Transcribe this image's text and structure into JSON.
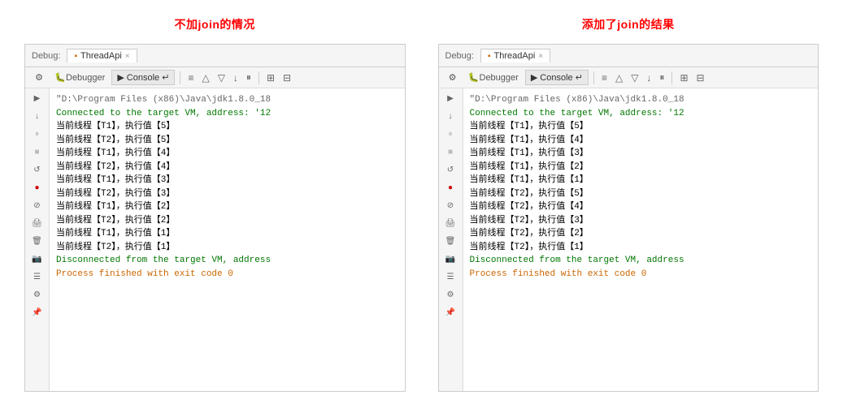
{
  "left_section": {
    "title": "不加join的情况",
    "debug_label": "Debug:",
    "tab_name": "ThreadApi",
    "toolbar": {
      "debugger_label": "Debugger",
      "console_label": "Console ↵"
    },
    "console_lines": [
      {
        "text": "\"D:\\Program Files (x86)\\Java\\jdk1.8.0_18",
        "class": "gray"
      },
      {
        "text": "Connected to the target VM, address: '12",
        "class": "green"
      },
      {
        "text": "当前线程【T1】，执行值【5】",
        "class": "black"
      },
      {
        "text": "当前线程【T2】，执行值【5】",
        "class": "black"
      },
      {
        "text": "当前线程【T1】，执行值【4】",
        "class": "black"
      },
      {
        "text": "当前线程【T2】，执行值【4】",
        "class": "black"
      },
      {
        "text": "当前线程【T1】，执行值【3】",
        "class": "black"
      },
      {
        "text": "当前线程【T2】，执行值【3】",
        "class": "black"
      },
      {
        "text": "当前线程【T1】，执行值【2】",
        "class": "black"
      },
      {
        "text": "当前线程【T2】，执行值【2】",
        "class": "black"
      },
      {
        "text": "当前线程【T1】，执行值【1】",
        "class": "black"
      },
      {
        "text": "当前线程【T2】，执行值【1】",
        "class": "black"
      },
      {
        "text": "Disconnected from the target VM, address",
        "class": "green"
      },
      {
        "text": "",
        "class": "black"
      },
      {
        "text": "Process finished with exit code 0",
        "class": "orange"
      }
    ]
  },
  "right_section": {
    "title": "添加了join的结果",
    "debug_label": "Debug:",
    "tab_name": "ThreadApi",
    "toolbar": {
      "debugger_label": "Debugger",
      "console_label": "Console ↵"
    },
    "console_lines": [
      {
        "text": "\"D:\\Program Files (x86)\\Java\\jdk1.8.0_18",
        "class": "gray"
      },
      {
        "text": "Connected to the target VM, address: '12",
        "class": "green"
      },
      {
        "text": "当前线程【T1】，执行值【5】",
        "class": "black"
      },
      {
        "text": "当前线程【T1】，执行值【4】",
        "class": "black"
      },
      {
        "text": "当前线程【T1】，执行值【3】",
        "class": "black"
      },
      {
        "text": "当前线程【T1】，执行值【2】",
        "class": "black"
      },
      {
        "text": "当前线程【T1】，执行值【1】",
        "class": "black"
      },
      {
        "text": "当前线程【T2】，执行值【5】",
        "class": "black"
      },
      {
        "text": "当前线程【T2】，执行值【4】",
        "class": "black"
      },
      {
        "text": "当前线程【T2】，执行值【3】",
        "class": "black"
      },
      {
        "text": "当前线程【T2】，执行值【2】",
        "class": "black"
      },
      {
        "text": "当前线程【T2】，执行值【1】",
        "class": "black"
      },
      {
        "text": "Disconnected from the target VM, address",
        "class": "green"
      },
      {
        "text": "",
        "class": "black"
      },
      {
        "text": "Process finished with exit code 0",
        "class": "orange"
      }
    ]
  }
}
